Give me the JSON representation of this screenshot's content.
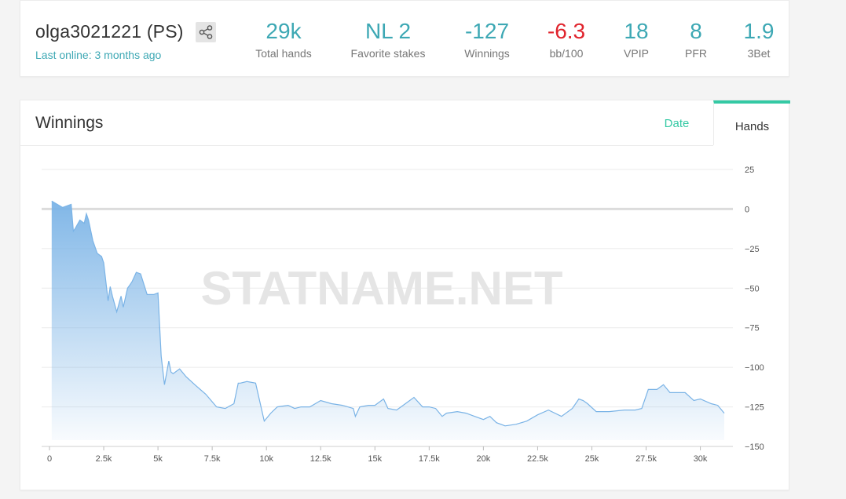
{
  "player": {
    "name": "olga3021221 (PS)",
    "last_online": "Last online: 3 months ago",
    "share_icon": "share-icon"
  },
  "stats": [
    {
      "value": "29k",
      "label": "Total hands",
      "negative": false
    },
    {
      "value": "NL 2",
      "label": "Favorite stakes",
      "negative": false
    },
    {
      "value": "-127",
      "label": "Winnings",
      "negative": false
    },
    {
      "value": "-6.3",
      "label": "bb/100",
      "negative": true
    },
    {
      "value": "18",
      "label": "VPIP",
      "negative": false
    },
    {
      "value": "8",
      "label": "PFR",
      "negative": false
    },
    {
      "value": "1.9",
      "label": "3Bet",
      "negative": false
    }
  ],
  "chart_panel": {
    "title": "Winnings",
    "tabs": [
      {
        "label": "Date",
        "active": false
      },
      {
        "label": "Hands",
        "active": true
      }
    ],
    "watermark": "STATNAME.NET"
  },
  "colors": {
    "accent": "#3da8b4",
    "negative": "#e0242d",
    "tab_active": "#34c9a4",
    "line": "#7ab3e6"
  },
  "chart_data": {
    "type": "area",
    "title": "",
    "xlabel": "",
    "ylabel": "",
    "xlim": [
      0,
      31500
    ],
    "ylim": [
      -150,
      25
    ],
    "x_ticks": [
      0,
      2500,
      5000,
      7500,
      10000,
      12500,
      15000,
      17500,
      20000,
      22500,
      25000,
      27500,
      30000
    ],
    "x_tick_labels": [
      "0",
      "2.5k",
      "5k",
      "7.5k",
      "10k",
      "12.5k",
      "15k",
      "17.5k",
      "20k",
      "22.5k",
      "25k",
      "27.5k",
      "30k"
    ],
    "y_ticks": [
      25,
      0,
      -25,
      -50,
      -75,
      -100,
      -125,
      -150
    ],
    "y_tick_labels": [
      "25",
      "0",
      "−25",
      "−50",
      "−75",
      "−100",
      "−125",
      "−150"
    ],
    "grid": true,
    "legend": "none",
    "series": [
      {
        "x": [
          100,
          600,
          1000,
          1100,
          1200,
          1400,
          1600,
          1700,
          1800,
          2000,
          2200,
          2400,
          2500,
          2700,
          2800,
          2900,
          3100,
          3300,
          3400,
          3600,
          3700,
          3800,
          4000,
          4200,
          4500,
          4800,
          5000,
          5150,
          5300,
          5500,
          5600,
          5700,
          6000,
          6300,
          6700,
          7200,
          7700,
          8100,
          8500,
          8700,
          8800,
          9100,
          9500,
          9900,
          10200,
          10500,
          11000,
          11300,
          11600,
          12000,
          12500,
          13000,
          13500,
          14000,
          14100,
          14300,
          14700,
          15000,
          15400,
          15600,
          16000,
          16300,
          16800,
          17200,
          17500,
          17800,
          18100,
          18300,
          18800,
          19200,
          19600,
          20000,
          20300,
          20600,
          21000,
          21500,
          22000,
          22500,
          23000,
          23600,
          24100,
          24400,
          24600,
          24800,
          25200,
          25800,
          26500,
          27000,
          27300,
          27600,
          28000,
          28300,
          28600,
          29000,
          29300,
          29700,
          30000,
          30500,
          30800,
          31100
        ],
        "values": [
          5,
          1,
          3,
          -14,
          -12,
          -7,
          -9,
          -3,
          -7,
          -20,
          -28,
          -30,
          -34,
          -58,
          -49,
          -55,
          -65,
          -55,
          -62,
          -50,
          -48,
          -46,
          -40,
          -41,
          -54,
          -54,
          -53,
          -93,
          -111,
          -96,
          -103,
          -104,
          -101,
          -106,
          -111,
          -117,
          -125,
          -126,
          -123,
          -110,
          -110,
          -109,
          -110,
          -134,
          -129,
          -125,
          -124,
          -126,
          -125,
          -125,
          -121,
          -123,
          -124,
          -126,
          -131,
          -125,
          -124,
          -124,
          -120,
          -126,
          -127,
          -124,
          -119,
          -125,
          -125,
          -126,
          -131,
          -129,
          -128,
          -129,
          -131,
          -133,
          -131,
          -135,
          -137,
          -136,
          -134,
          -130,
          -127,
          -131,
          -126,
          -120,
          -121,
          -123,
          -128,
          -128,
          -127,
          -127,
          -126,
          -114,
          -114,
          -111,
          -116,
          -116,
          -116,
          -121,
          -120,
          -123,
          -124,
          -129
        ]
      }
    ]
  }
}
